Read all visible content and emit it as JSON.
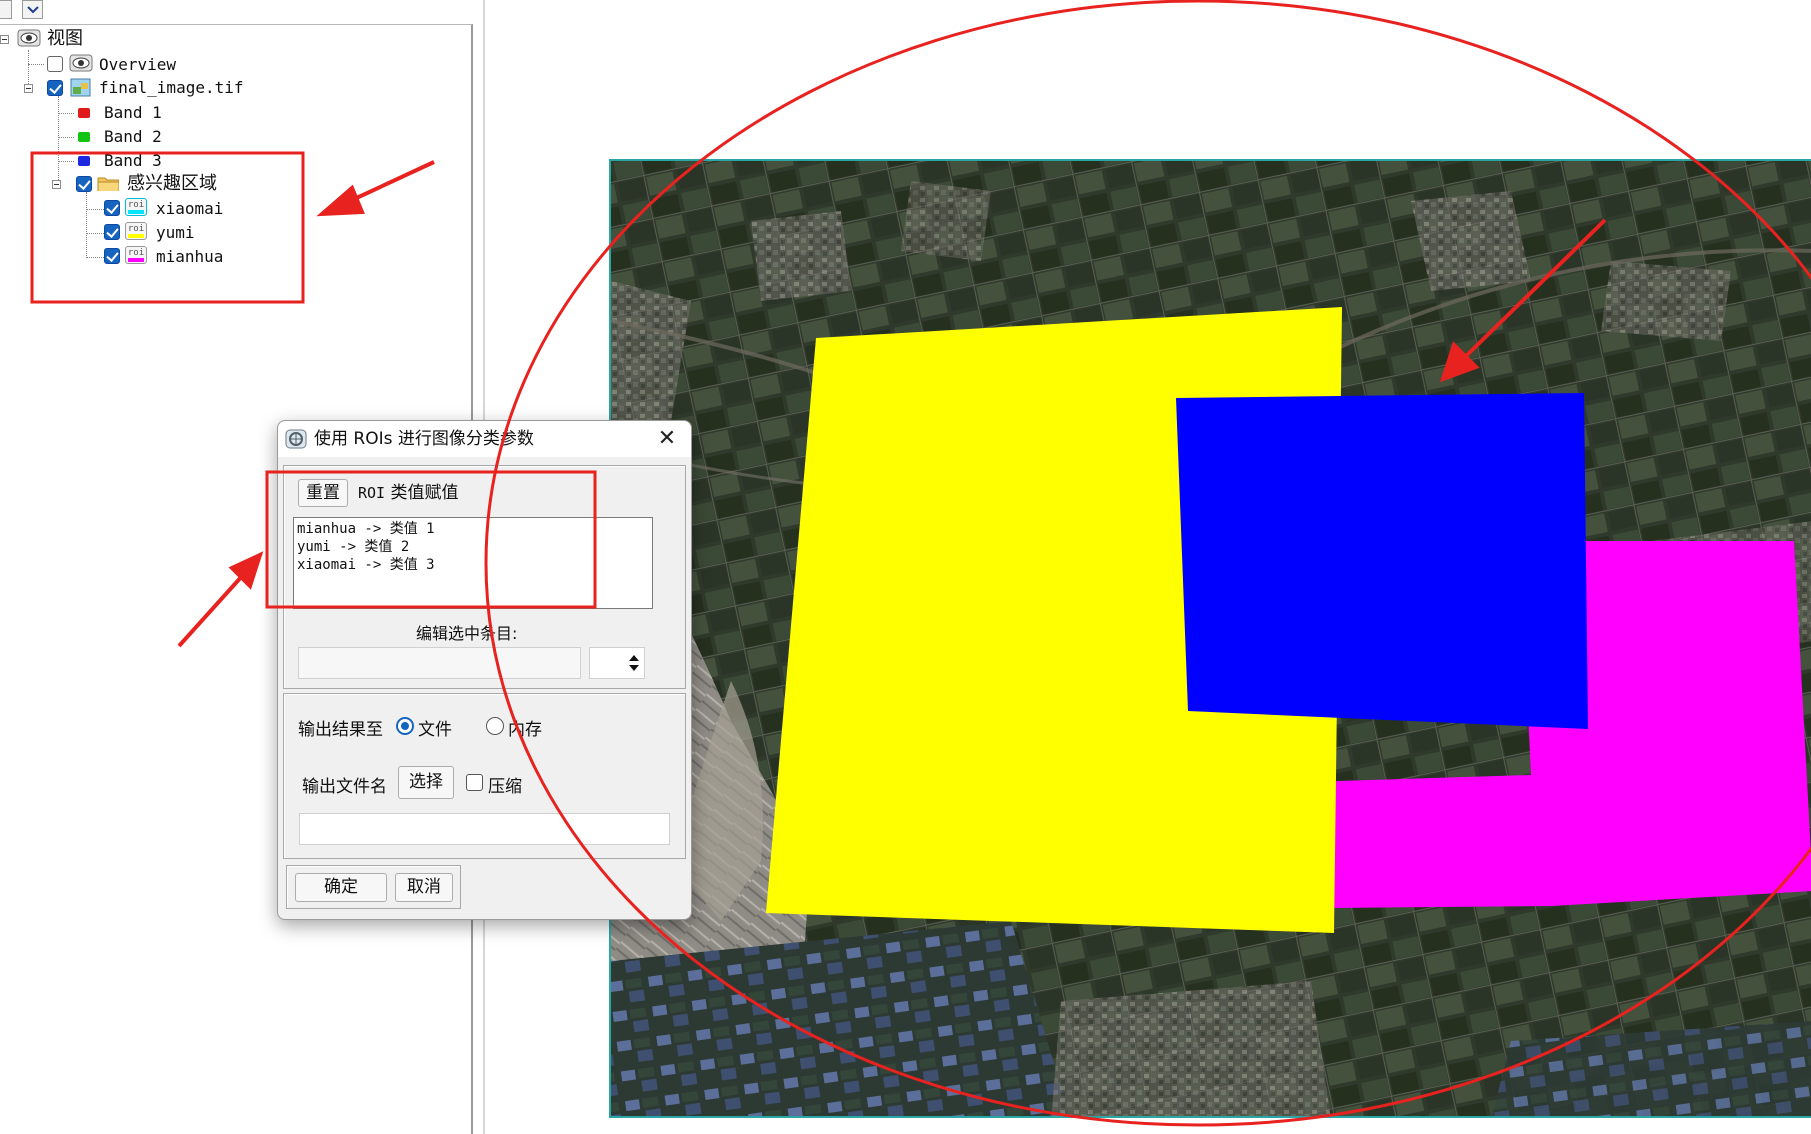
{
  "tree": {
    "root_label": "视图",
    "items": [
      {
        "label": "Overview",
        "checked": false,
        "icon": "eye-icon"
      },
      {
        "label": "final_image.tif",
        "checked": true,
        "icon": "raster-image-icon"
      },
      {
        "label": "Band 1",
        "icon": "band-red-icon",
        "color": "#e01b1b"
      },
      {
        "label": "Band 2",
        "icon": "band-green-icon",
        "color": "#13c413"
      },
      {
        "label": "Band 3",
        "icon": "band-blue-icon",
        "color": "#1e28e0"
      },
      {
        "label": "感兴趣区域",
        "checked": true,
        "icon": "folder-icon"
      },
      {
        "label": "xiaomai",
        "checked": true,
        "icon": "roi-icon",
        "color": "#00e5ff"
      },
      {
        "label": "yumi",
        "checked": true,
        "icon": "roi-icon",
        "color": "#ffff00"
      },
      {
        "label": "mianhua",
        "checked": true,
        "icon": "roi-icon",
        "color": "#ff00ff"
      }
    ]
  },
  "roi_badge": "roi",
  "dialog": {
    "title": "使用 ROIs 进行图像分类参数",
    "close_glyph": "✕",
    "reset_button": "重置",
    "roi_label_prefix": "ROI",
    "roi_label_suffix": "类值赋值",
    "assignments": [
      "mianhua -> 类值 1",
      "yumi -> 类值 2",
      "xiaomai -> 类值 3"
    ],
    "edit_label": "编辑选中条目:",
    "output_to_label": "输出结果至",
    "output_options": [
      "文件",
      "内存"
    ],
    "output_selected": "文件",
    "filename_label": "输出文件名",
    "choose_button": "选择",
    "compress_label": "压缩",
    "compress_checked": false,
    "ok_button": "确定",
    "cancel_button": "取消"
  },
  "map": {
    "roi_colors": {
      "yumi": "#ffff00",
      "xiaomai": "#0000ff",
      "mianhua": "#ff00ff"
    }
  },
  "annotation_color": "#e8221f"
}
